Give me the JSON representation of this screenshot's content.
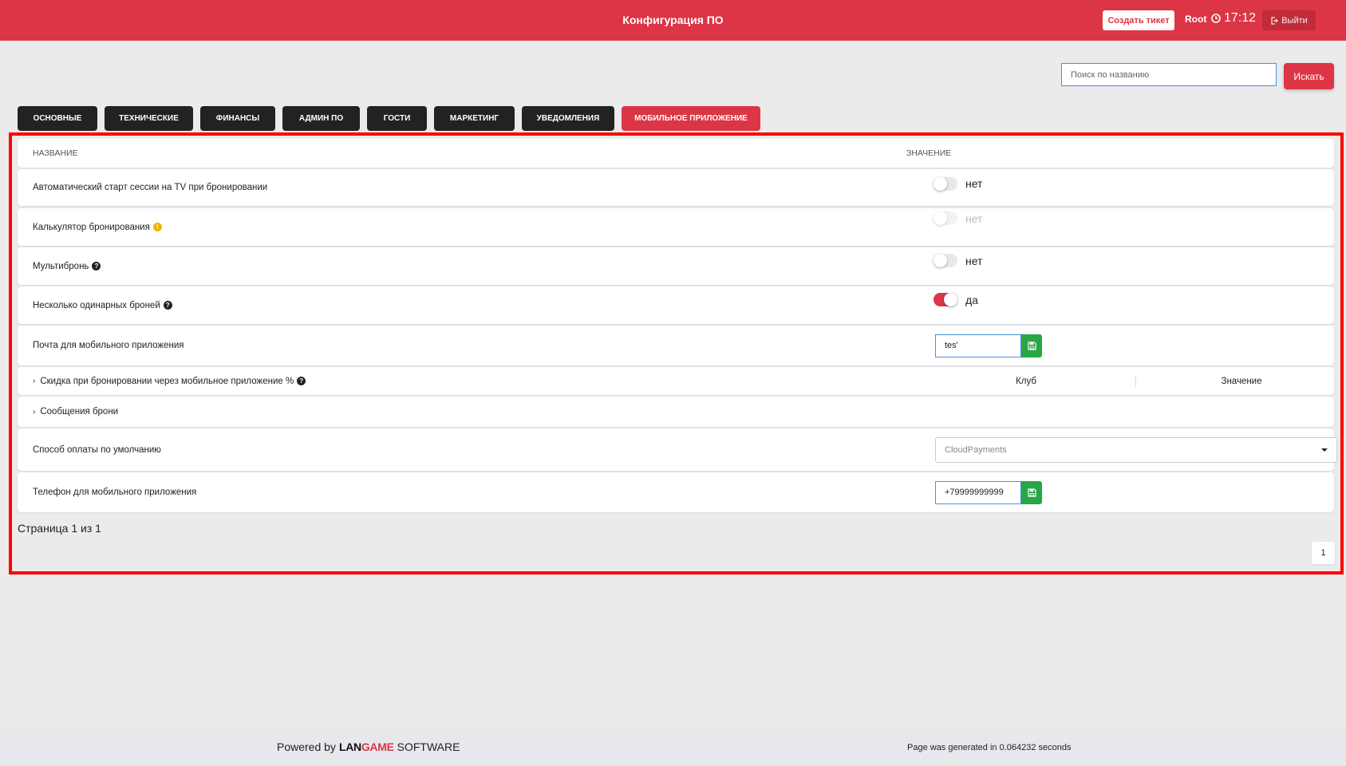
{
  "header": {
    "title": "Конфигурация ПО",
    "create_ticket_label": "Создать тикет",
    "user": "Root",
    "time": "17:12",
    "logout_label": "Выйти"
  },
  "search": {
    "placeholder": "Поиск по названию",
    "button_label": "Искать"
  },
  "tabs": [
    {
      "label": "Основные",
      "active": false
    },
    {
      "label": "Технические",
      "active": false
    },
    {
      "label": "Финансы",
      "active": false
    },
    {
      "label": "Админ ПО",
      "active": false
    },
    {
      "label": "Гости",
      "active": false
    },
    {
      "label": "Маркетинг",
      "active": false
    },
    {
      "label": "Уведомления",
      "active": false
    },
    {
      "label": "Мобильное приложение",
      "active": true
    }
  ],
  "table": {
    "col_name": "Название",
    "col_value": "Значение",
    "rows": [
      {
        "name": "Автоматический старт сессии на TV при бронировании",
        "toggle": false,
        "value_text": "нет"
      },
      {
        "name": "Калькулятор бронирования",
        "toggle": false,
        "value_text": "нет",
        "disabled": true
      },
      {
        "name": "Мультибронь",
        "toggle": false,
        "value_text": "нет"
      },
      {
        "name": "Несколько одинарных броней",
        "toggle": true,
        "value_text": "да"
      },
      {
        "name": "Почта для мобильного приложения",
        "input_value": "tes'"
      },
      {
        "name": "Скидка при бронировании через мобильное приложение %",
        "sub_col_club": "Клуб",
        "sub_col_value": "Значение"
      },
      {
        "name": "Сообщения брони"
      },
      {
        "name": "Способ оплаты по умолчанию",
        "select_value": "CloudPayments"
      },
      {
        "name": "Телефон для мобильного приложения",
        "input_value": "+79999999999"
      }
    ]
  },
  "pagination": {
    "text": "Страница 1 из 1",
    "current_page": "1"
  },
  "footer": {
    "powered_by": "Powered by",
    "brand_part1": "LAN",
    "brand_part2": "GAME",
    "brand_part3": "SOFTWARE",
    "generated": "Page was generated in 0.064232 seconds"
  },
  "colors": {
    "primary": "#dc3545",
    "dark": "#222222",
    "success": "#28a745",
    "highlight_frame": "#ff0000"
  }
}
